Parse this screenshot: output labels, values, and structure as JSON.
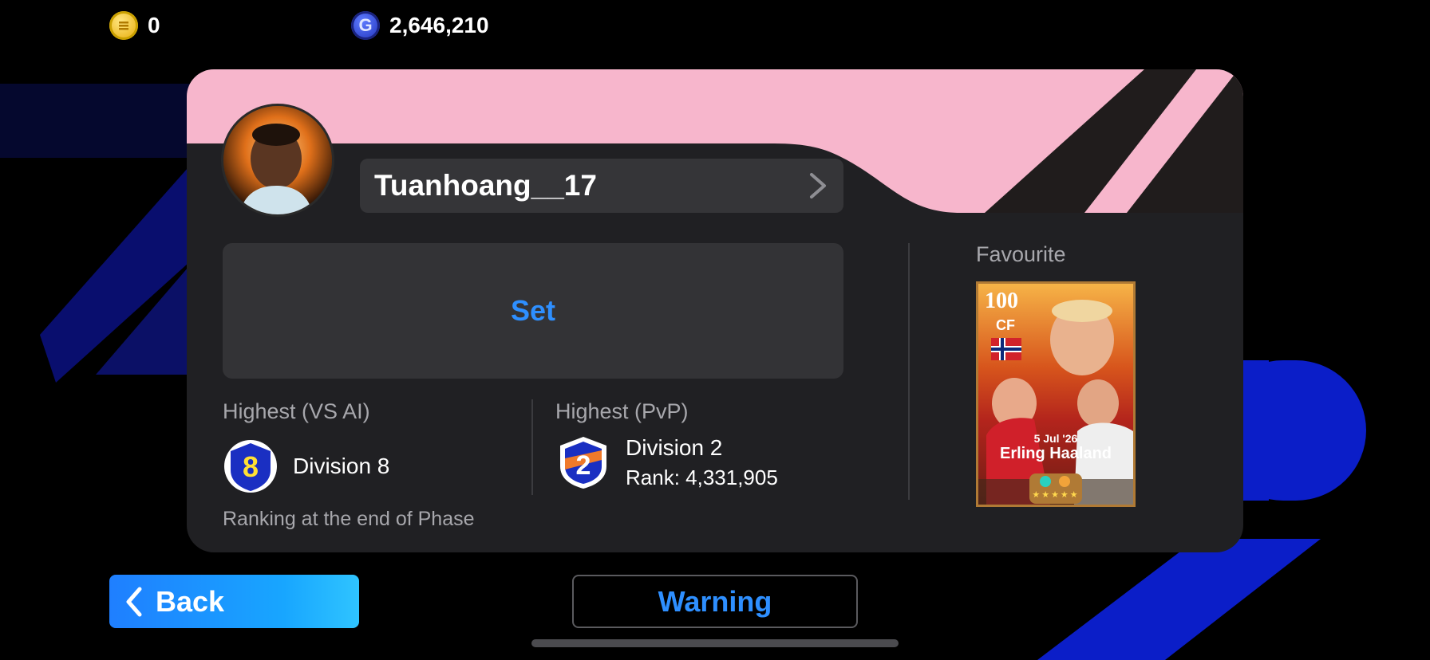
{
  "currencies": [
    {
      "icon": "gold-coin-icon",
      "value": "0"
    },
    {
      "icon": "gp-coin-icon",
      "value": "2,646,210"
    }
  ],
  "profile": {
    "name": "Tuanhoang__17",
    "set_label": "Set"
  },
  "stats": {
    "vs_ai": {
      "title": "Highest (VS AI)",
      "division": "Division 8",
      "badge_number": "8"
    },
    "pvp": {
      "title": "Highest (PvP)",
      "division": "Division 2",
      "rank": "Rank: 4,331,905",
      "badge_number": "2"
    },
    "note": "Ranking at the end of Phase"
  },
  "favourite": {
    "label": "Favourite",
    "rating": "100",
    "position": "CF",
    "date": "5 Jul '26",
    "player_name": "Erling Haaland",
    "stars": "★★★★★"
  },
  "buttons": {
    "back": "Back",
    "warning": "Warning"
  },
  "colors": {
    "accent_blue": "#2e8fff",
    "pink": "#f7b6cc",
    "card_bg": "#202023"
  }
}
